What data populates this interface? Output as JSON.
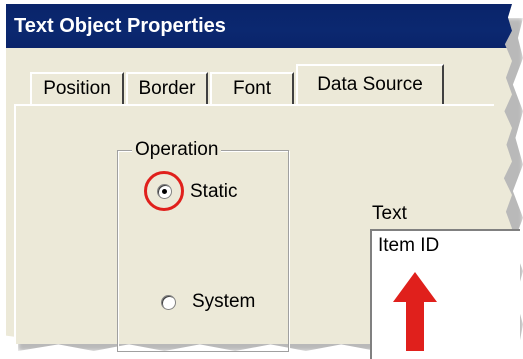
{
  "window": {
    "title": "Text Object Properties"
  },
  "tabs": [
    {
      "label": "Position",
      "active": false
    },
    {
      "label": "Border",
      "active": false
    },
    {
      "label": "Font",
      "active": false
    },
    {
      "label": "Data Source",
      "active": true
    }
  ],
  "operation": {
    "label": "Operation",
    "options": [
      {
        "label": "Static",
        "selected": true
      },
      {
        "label": "System",
        "selected": false
      }
    ]
  },
  "text_field": {
    "label": "Text",
    "value": "Item ID"
  },
  "annotations": {
    "highlight_color": "#e0201c",
    "arrow_color": "#e0201c",
    "arrow_icon": "arrow-up-icon",
    "ring_icon": "highlight-circle-icon"
  },
  "colors": {
    "titlebar": "#0a246a",
    "dialog_bg": "#ece9d8"
  }
}
